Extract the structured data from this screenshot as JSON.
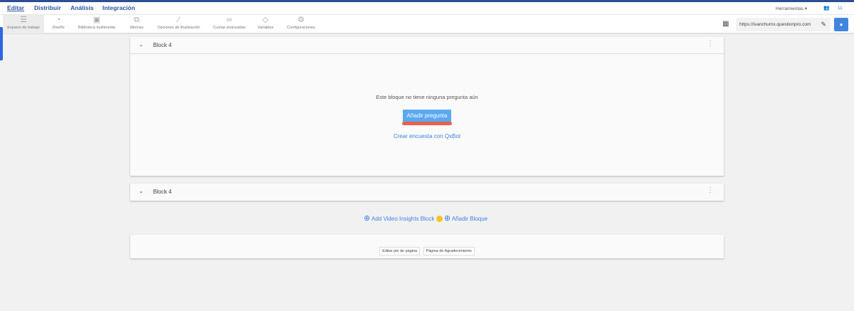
{
  "nav": {
    "tabs": [
      "Editar",
      "Distribuir",
      "Análisis",
      "Integración"
    ],
    "tools_label": "Herramientas",
    "user_count": "11"
  },
  "toolbar": {
    "items": [
      {
        "label": "Espacio de trabajo",
        "icon": "workspace-icon"
      },
      {
        "label": "Diseño",
        "icon": "palette-icon"
      },
      {
        "label": "Biblioteca multimedia",
        "icon": "image-icon"
      },
      {
        "label": "Idiomas",
        "icon": "language-icon"
      },
      {
        "label": "Opciones de finalización",
        "icon": "wand-icon"
      },
      {
        "label": "Cuotas avanzadas",
        "icon": "link-icon"
      },
      {
        "label": "Variables",
        "icon": "tag-icon"
      },
      {
        "label": "Configuraciones",
        "icon": "gear-icon"
      }
    ],
    "url": "https://ivanchumx.questionpro.com"
  },
  "blocks": [
    {
      "title": "Block 4",
      "empty_text": "Este bloque no tiene ninguna pregunta aún",
      "add_question": "Añadir pregunta",
      "qxbot": "Crear encuesta con QxBot"
    },
    {
      "title": "Block 4"
    }
  ],
  "actions": {
    "add_video": "Add Video Insights Block",
    "add_block": "Añadir Bloque"
  },
  "footer": {
    "edit_footer": "Editar pie de página",
    "thanks_page": "Página de Agradecimiento"
  }
}
